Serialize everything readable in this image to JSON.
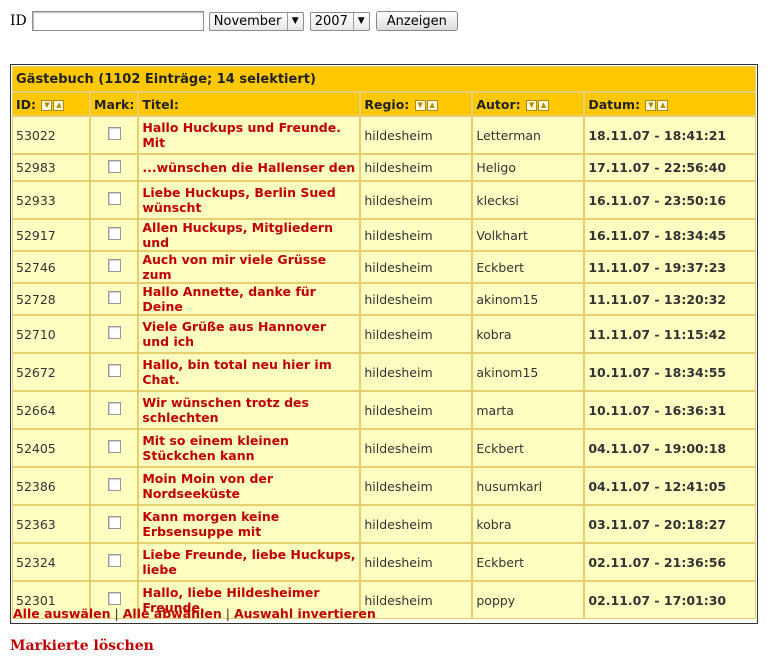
{
  "toolbar": {
    "id_label": "ID",
    "id_value": "",
    "month": "November",
    "year": "2007",
    "submit_label": "Anzeigen"
  },
  "guestbook": {
    "title": "Gästebuch (1102 Einträge; 14 selektiert)",
    "columns": {
      "id": "ID:",
      "mark": "Mark:",
      "title": "Titel:",
      "region": "Regio:",
      "author": "Autor:",
      "date": "Datum:"
    },
    "rows": [
      {
        "id": "53022",
        "title": "Hallo Huckups und Freunde. Mit",
        "region": "hildesheim",
        "author": "Letterman",
        "date": "18.11.07 - 18:41:21"
      },
      {
        "id": "52983",
        "title": "...wünschen die Hallenser den",
        "region": "hildesheim",
        "author": "Heligo",
        "date": "17.11.07 - 22:56:40"
      },
      {
        "id": "52933",
        "title": "Liebe Huckups, Berlin Sued wünscht",
        "region": "hildesheim",
        "author": "klecksi",
        "date": "16.11.07 - 23:50:16"
      },
      {
        "id": "52917",
        "title": "Allen Huckups, Mitgliedern und",
        "region": "hildesheim",
        "author": "Volkhart",
        "date": "16.11.07 - 18:34:45"
      },
      {
        "id": "52746",
        "title": "Auch von mir viele Grüsse zum",
        "region": "hildesheim",
        "author": "Eckbert",
        "date": "11.11.07 - 19:37:23"
      },
      {
        "id": "52728",
        "title": "Hallo Annette, danke für Deine",
        "region": "hildesheim",
        "author": "akinom15",
        "date": "11.11.07 - 13:20:32"
      },
      {
        "id": "52710",
        "title": "Viele Grüße aus Hannover und ich",
        "region": "hildesheim",
        "author": "kobra",
        "date": "11.11.07 - 11:15:42"
      },
      {
        "id": "52672",
        "title": "Hallo, bin total neu hier im Chat.",
        "region": "hildesheim",
        "author": "akinom15",
        "date": "10.11.07 - 18:34:55"
      },
      {
        "id": "52664",
        "title": "Wir wünschen trotz des schlechten",
        "region": "hildesheim",
        "author": "marta",
        "date": "10.11.07 - 16:36:31"
      },
      {
        "id": "52405",
        "title": "Mit so einem kleinen Stückchen kann",
        "region": "hildesheim",
        "author": "Eckbert",
        "date": "04.11.07 - 19:00:18"
      },
      {
        "id": "52386",
        "title": "Moin Moin von der Nordseeküste",
        "region": "hildesheim",
        "author": "husumkarl",
        "date": "04.11.07 - 12:41:05"
      },
      {
        "id": "52363",
        "title": "Kann morgen keine Erbsensuppe mit",
        "region": "hildesheim",
        "author": "kobra",
        "date": "03.11.07 - 20:18:27"
      },
      {
        "id": "52324",
        "title": "Liebe Freunde, liebe Huckups, liebe",
        "region": "hildesheim",
        "author": "Eckbert",
        "date": "02.11.07 - 21:36:56"
      },
      {
        "id": "52301",
        "title": "Hallo, liebe Hildesheimer Freunde,",
        "region": "hildesheim",
        "author": "poppy",
        "date": "02.11.07 - 17:01:30"
      }
    ],
    "footer": {
      "select_all": "Alle auswälen",
      "deselect_all": "Alle abwählen",
      "invert": "Auswahl invertieren",
      "separator": "|"
    }
  },
  "delete_label": "Markierte löschen"
}
